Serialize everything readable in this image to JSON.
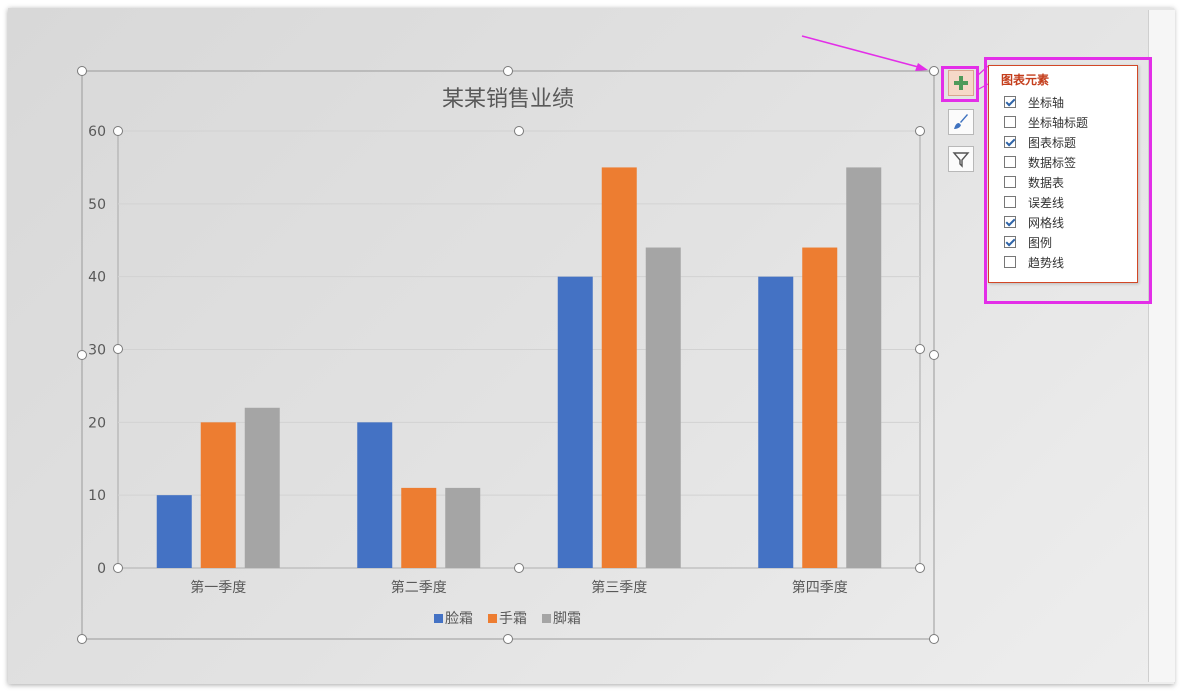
{
  "chart_data": {
    "type": "bar",
    "title": "某某销售业绩",
    "categories": [
      "第一季度",
      "第二季度",
      "第三季度",
      "第四季度"
    ],
    "series": [
      {
        "name": "脸霜",
        "color": "#4472c4",
        "values": [
          10,
          20,
          40,
          40
        ]
      },
      {
        "name": "手霜",
        "color": "#ed7d31",
        "values": [
          20,
          11,
          55,
          44
        ]
      },
      {
        "name": "脚霜",
        "color": "#a5a5a5",
        "values": [
          22,
          11,
          44,
          55
        ]
      }
    ],
    "yticks": [
      "0",
      "10",
      "20",
      "30",
      "40",
      "50",
      "60"
    ],
    "ylim": [
      0,
      60
    ],
    "grid": true,
    "legend": "bottom"
  },
  "flyout": {
    "title": "图表元素",
    "items": [
      {
        "label": "坐标轴",
        "checked": true
      },
      {
        "label": "坐标轴标题",
        "checked": false
      },
      {
        "label": "图表标题",
        "checked": true
      },
      {
        "label": "数据标签",
        "checked": false
      },
      {
        "label": "数据表",
        "checked": false
      },
      {
        "label": "误差线",
        "checked": false
      },
      {
        "label": "网格线",
        "checked": true
      },
      {
        "label": "图例",
        "checked": true
      },
      {
        "label": "趋势线",
        "checked": false
      }
    ]
  },
  "side_buttons": [
    {
      "icon": "plus-icon"
    },
    {
      "icon": "paintbrush-icon"
    },
    {
      "icon": "filter-icon"
    }
  ],
  "colors": {
    "highlight": "#e32ee8",
    "accent": "#c43e1c"
  }
}
